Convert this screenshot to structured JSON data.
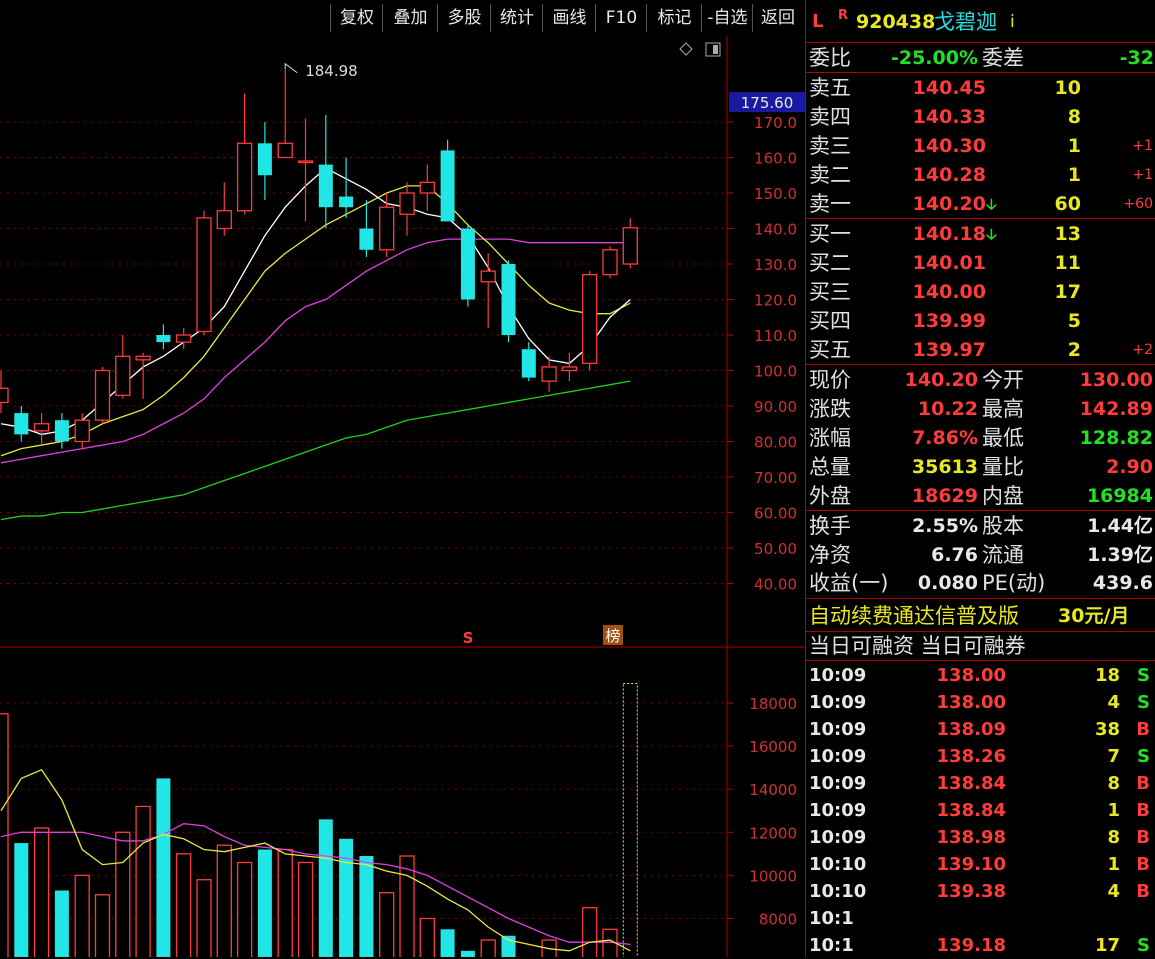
{
  "toolbar": {
    "buttons": [
      "复权",
      "叠加",
      "多股",
      "统计",
      "画线",
      "F10",
      "标记",
      "-自选",
      "返回"
    ]
  },
  "stock": {
    "prefix": "L",
    "flag": "R",
    "code": "920438",
    "name": "戈碧迦",
    "info": "i"
  },
  "kline": {
    "last_price_tag": "175.60",
    "high_annot": "184.98",
    "y_axis": [
      "170.0",
      "160.0",
      "150.0",
      "140.0",
      "130.0",
      "120.0",
      "110.0",
      "100.0",
      "90.00",
      "80.00",
      "70.00",
      "60.00",
      "50.00",
      "40.00"
    ],
    "marker_s": "S",
    "marker_bang": "榜",
    "colors": {
      "up": "#ff3b3b",
      "down": "#22e5e5",
      "ma5": "#ffffff",
      "ma10": "#e8e840",
      "ma20": "#e040e0",
      "ma60": "#20d020",
      "grid": "#800000"
    }
  },
  "chart_data": {
    "type": "candlestick",
    "candles": [
      {
        "o": 91,
        "c": 95,
        "h": 100,
        "l": 88
      },
      {
        "o": 88,
        "c": 82,
        "h": 90,
        "l": 80
      },
      {
        "o": 83,
        "c": 85,
        "h": 88,
        "l": 79
      },
      {
        "o": 86,
        "c": 80,
        "h": 88,
        "l": 78
      },
      {
        "o": 80,
        "c": 86,
        "h": 88,
        "l": 78
      },
      {
        "o": 86,
        "c": 100,
        "h": 101,
        "l": 85
      },
      {
        "o": 93,
        "c": 104,
        "h": 110,
        "l": 92
      },
      {
        "o": 103,
        "c": 104,
        "h": 105,
        "l": 92
      },
      {
        "o": 110,
        "c": 108,
        "h": 113,
        "l": 106
      },
      {
        "o": 108,
        "c": 110,
        "h": 112,
        "l": 106
      },
      {
        "o": 111,
        "c": 143,
        "h": 145,
        "l": 110
      },
      {
        "o": 140,
        "c": 145,
        "h": 153,
        "l": 138
      },
      {
        "o": 145,
        "c": 164,
        "h": 178,
        "l": 144
      },
      {
        "o": 164,
        "c": 155,
        "h": 170,
        "l": 148
      },
      {
        "o": 160,
        "c": 164,
        "h": 185,
        "l": 160
      },
      {
        "o": 159,
        "c": 159,
        "h": 171,
        "l": 142
      },
      {
        "o": 158,
        "c": 146,
        "h": 172,
        "l": 140
      },
      {
        "o": 149,
        "c": 146,
        "h": 160,
        "l": 143
      },
      {
        "o": 140,
        "c": 134,
        "h": 148,
        "l": 132
      },
      {
        "o": 134,
        "c": 146,
        "h": 150,
        "l": 132
      },
      {
        "o": 144,
        "c": 150,
        "h": 153,
        "l": 138
      },
      {
        "o": 150,
        "c": 153,
        "h": 158,
        "l": 145
      },
      {
        "o": 162,
        "c": 142,
        "h": 165,
        "l": 142
      },
      {
        "o": 140,
        "c": 120,
        "h": 141,
        "l": 118
      },
      {
        "o": 125,
        "c": 128,
        "h": 133,
        "l": 112
      },
      {
        "o": 130,
        "c": 110,
        "h": 131,
        "l": 108
      },
      {
        "o": 106,
        "c": 98,
        "h": 108,
        "l": 97
      },
      {
        "o": 97,
        "c": 101,
        "h": 104,
        "l": 94
      },
      {
        "o": 100,
        "c": 101,
        "h": 105,
        "l": 97
      },
      {
        "o": 102,
        "c": 127,
        "h": 128,
        "l": 100
      },
      {
        "o": 127,
        "c": 134,
        "h": 135,
        "l": 126
      },
      {
        "o": 130,
        "c": 140.2,
        "h": 142.89,
        "l": 128.82
      }
    ],
    "ma5": [
      85,
      84,
      82,
      83,
      86,
      91,
      96,
      101,
      104,
      108,
      112,
      118,
      128,
      138,
      146,
      152,
      157,
      154,
      151,
      147,
      146,
      144,
      143,
      138,
      129,
      118,
      109,
      103,
      102,
      107,
      115,
      120
    ],
    "ma10": [
      76,
      78,
      79,
      80,
      82,
      85,
      87,
      89,
      93,
      98,
      104,
      112,
      120,
      128,
      133,
      137,
      141,
      144,
      147,
      150,
      152,
      152,
      147,
      141,
      136,
      130,
      124,
      119,
      117,
      116,
      116,
      119
    ],
    "ma20": [
      74,
      75,
      76,
      77,
      78,
      79,
      80,
      82,
      85,
      88,
      92,
      98,
      103,
      108,
      114,
      118,
      120,
      124,
      128,
      131,
      134,
      136,
      137,
      137,
      137,
      137,
      136,
      136,
      136,
      136,
      136,
      136
    ],
    "ma60": [
      58,
      59,
      59,
      60,
      60,
      61,
      62,
      63,
      64,
      65,
      67,
      69,
      71,
      73,
      75,
      77,
      79,
      81,
      82,
      84,
      86,
      87,
      88,
      89,
      90,
      91,
      92,
      93,
      94,
      95,
      96,
      97
    ],
    "volume": {
      "y_axis": [
        "18000",
        "16000",
        "14000",
        "12000",
        "10000",
        "8000"
      ],
      "bars": [
        17500,
        11500,
        12200,
        9300,
        10000,
        9100,
        12000,
        13200,
        14500,
        11000,
        9800,
        11400,
        10600,
        11200,
        11200,
        10600,
        12600,
        11700,
        10900,
        9200,
        10900,
        8000,
        7500,
        6500,
        7000,
        7200,
        6000,
        7000,
        5600,
        8500,
        7500,
        19000
      ],
      "ma5": [
        13000,
        14500,
        14900,
        13500,
        11200,
        10500,
        10600,
        11500,
        11900,
        11700,
        11200,
        11100,
        11300,
        11500,
        11000,
        10900,
        10800,
        10600,
        10500,
        10200,
        10000,
        9500,
        8900,
        8400,
        7600,
        7000,
        6800,
        6600,
        6500,
        6900,
        7000,
        6500
      ],
      "ma10": [
        11800,
        12000,
        12000,
        12000,
        12000,
        11800,
        11600,
        11600,
        11900,
        12400,
        12300,
        11800,
        11400,
        11300,
        11200,
        11000,
        10900,
        10800,
        10600,
        10500,
        10300,
        10000,
        9500,
        9000,
        8500,
        8000,
        7600,
        7200,
        6900,
        6900,
        6900,
        6800
      ]
    }
  },
  "quote": {
    "weibi_label": "委比",
    "weibi": "-25.00%",
    "weicha_label": "委差",
    "weicha": "-32",
    "asks": [
      {
        "label": "卖五",
        "price": "140.45",
        "vol": "10",
        "chg": "",
        "arrow": ""
      },
      {
        "label": "卖四",
        "price": "140.33",
        "vol": "8",
        "chg": "",
        "arrow": ""
      },
      {
        "label": "卖三",
        "price": "140.30",
        "vol": "1",
        "chg": "+1",
        "arrow": ""
      },
      {
        "label": "卖二",
        "price": "140.28",
        "vol": "1",
        "chg": "+1",
        "arrow": ""
      },
      {
        "label": "卖一",
        "price": "140.20",
        "vol": "60",
        "chg": "+60",
        "arrow": "🡣"
      }
    ],
    "bids": [
      {
        "label": "买一",
        "price": "140.18",
        "vol": "13",
        "chg": "",
        "arrow": "🡣"
      },
      {
        "label": "买二",
        "price": "140.01",
        "vol": "11",
        "chg": "",
        "arrow": ""
      },
      {
        "label": "买三",
        "price": "140.00",
        "vol": "17",
        "chg": "",
        "arrow": ""
      },
      {
        "label": "买四",
        "price": "139.99",
        "vol": "5",
        "chg": "",
        "arrow": ""
      },
      {
        "label": "买五",
        "price": "139.97",
        "vol": "2",
        "chg": "+2",
        "arrow": ""
      }
    ],
    "stats": [
      {
        "l1": "现价",
        "v1": "140.20",
        "c1": "red",
        "l2": "今开",
        "v2": "130.00",
        "c2": "red"
      },
      {
        "l1": "涨跌",
        "v1": "10.22",
        "c1": "red",
        "l2": "最高",
        "v2": "142.89",
        "c2": "red"
      },
      {
        "l1": "涨幅",
        "v1": "7.86%",
        "c1": "red",
        "l2": "最低",
        "v2": "128.82",
        "c2": "grn"
      },
      {
        "l1": "总量",
        "v1": "35613",
        "c1": "yel",
        "l2": "量比",
        "v2": "2.90",
        "c2": "red"
      },
      {
        "l1": "外盘",
        "v1": "18629",
        "c1": "red",
        "l2": "内盘",
        "v2": "16984",
        "c2": "grn"
      }
    ],
    "fundamentals": [
      {
        "l1": "换手",
        "v1": "2.55%",
        "l2": "股本",
        "v2": "1.44亿"
      },
      {
        "l1": "净资",
        "v1": "6.76",
        "l2": "流通",
        "v2": "1.39亿"
      },
      {
        "l1": "收益(一)",
        "v1": "0.080",
        "l2": "PE(动)",
        "v2": "439.6"
      }
    ],
    "promo_text": "自动续费通达信普及版",
    "promo_price": "30元/月",
    "margin_text": "当日可融资 当日可融券"
  },
  "ticks": [
    {
      "time": "10:09",
      "price": "138.00",
      "vol": "18",
      "bs": "S"
    },
    {
      "time": "10:09",
      "price": "138.00",
      "vol": "4",
      "bs": "S"
    },
    {
      "time": "10:09",
      "price": "138.09",
      "vol": "38",
      "bs": "B"
    },
    {
      "time": "10:09",
      "price": "138.26",
      "vol": "7",
      "bs": "S"
    },
    {
      "time": "10:09",
      "price": "138.84",
      "vol": "8",
      "bs": "B"
    },
    {
      "time": "10:09",
      "price": "138.84",
      "vol": "1",
      "bs": "B"
    },
    {
      "time": "10:09",
      "price": "138.98",
      "vol": "8",
      "bs": "B"
    },
    {
      "time": "10:10",
      "price": "139.10",
      "vol": "1",
      "bs": "B"
    },
    {
      "time": "10:10",
      "price": "139.38",
      "vol": "4",
      "bs": "B"
    },
    {
      "time": "10:1",
      "price": "",
      "vol": "",
      "bs": ""
    },
    {
      "time": "10:1",
      "price": "139.18",
      "vol": "17",
      "bs": "S"
    }
  ]
}
